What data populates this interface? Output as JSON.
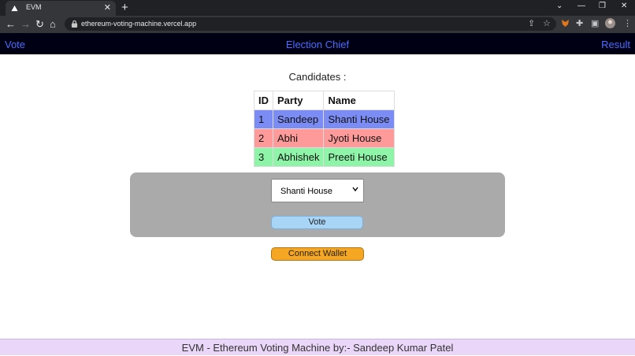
{
  "browser": {
    "tab_title": "EVM",
    "url": "ethereum-voting-machine.vercel.app",
    "new_tab": "+",
    "close": "✕",
    "win_collapse": "⌄",
    "win_minimize": "—",
    "win_restore": "❐",
    "win_close": "✕",
    "back": "←",
    "forward": "→",
    "reload": "↻",
    "home": "⌂",
    "share": "⇪",
    "star": "☆",
    "extensions": "✚",
    "sidebar": "▣",
    "menu": "⋮"
  },
  "appnav": {
    "vote": "Vote",
    "chief": "Election Chief",
    "result": "Result"
  },
  "main": {
    "heading": "Candidates :",
    "columns": [
      "ID",
      "Party",
      "Name"
    ],
    "rows": [
      {
        "id": "1",
        "party": "Sandeep",
        "name": "Shanti House",
        "color": "#7b8cf5"
      },
      {
        "id": "2",
        "party": "Abhi",
        "name": "Jyoti House",
        "color": "#ff9a9a"
      },
      {
        "id": "3",
        "party": "Abhishek",
        "name": "Preeti House",
        "color": "#8ef5a8"
      }
    ],
    "select_value": "Shanti House",
    "vote_label": "Vote",
    "connect_label": "Connect Wallet"
  },
  "footer": {
    "text": "EVM - Ethereum Voting Machine by:- Sandeep Kumar Patel"
  },
  "colors": {
    "nav_bg": "#000014",
    "nav_link": "#4a6cff",
    "panel": "#aaaaaa",
    "vote_btn": "#a8d4f6",
    "connect_btn": "#f5a623",
    "footer_bg": "#ead6f8"
  }
}
